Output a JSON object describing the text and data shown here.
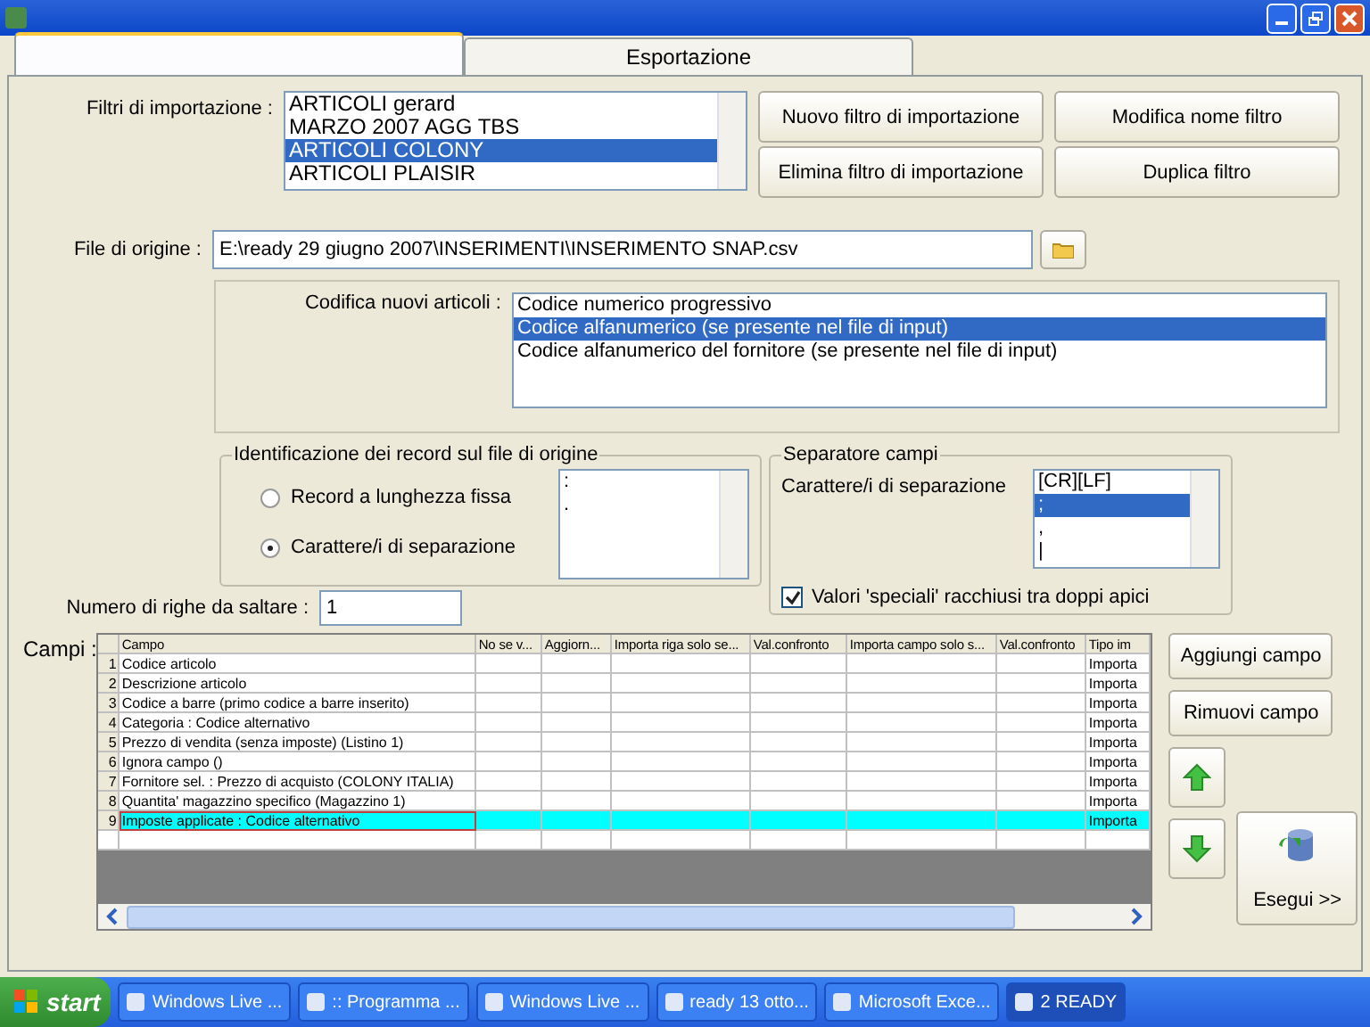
{
  "tabs": [
    {
      "selected": true
    },
    {
      "label": "Esportazione",
      "selected": false
    }
  ],
  "filters": {
    "label": "Filtri di importazione :",
    "items": [
      {
        "text": "ARTICOLI gerard",
        "selected": false
      },
      {
        "text": "MARZO 2007 AGG TBS",
        "selected": false
      },
      {
        "text": "ARTICOLI COLONY",
        "selected": true
      },
      {
        "text": "ARTICOLI PLAISIR",
        "selected": false
      }
    ],
    "buttons": [
      "Nuovo filtro di importazione",
      "Modifica nome filtro",
      "Elimina filtro di importazione",
      "Duplica filtro"
    ]
  },
  "file": {
    "label": "File di origine :",
    "value": "E:\\ready 29 giugno 2007\\INSERIMENTI\\INSERIMENTO SNAP.csv"
  },
  "coding": {
    "label": "Codifica nuovi articoli :",
    "items": [
      {
        "text": "Codice numerico progressivo",
        "selected": false
      },
      {
        "text": "Codice alfanumerico (se presente nel file di input)",
        "selected": true
      },
      {
        "text": "Codice alfanumerico del fornitore (se presente nel file di input)",
        "selected": false
      }
    ]
  },
  "identification": {
    "title": "Identificazione dei record sul file di origine",
    "options": [
      {
        "label": "Record a lunghezza fissa",
        "checked": false
      },
      {
        "label": "Carattere/i di separazione",
        "checked": true
      }
    ],
    "list": [
      {
        "text": ":",
        "selected": false
      },
      {
        "text": ".",
        "selected": false
      }
    ]
  },
  "separator": {
    "title": "Separatore campi",
    "label": "Carattere/i di separazione",
    "items": [
      {
        "text": "[CR][LF]",
        "selected": false
      },
      {
        "text": ";",
        "selected": true
      },
      {
        "text": ",",
        "selected": false
      },
      {
        "text": "|",
        "selected": false
      }
    ],
    "quotes": {
      "label": "Valori 'speciali' racchiusi tra doppi apici",
      "checked": true
    }
  },
  "skip_rows": {
    "label": "Numero di righe da saltare  :",
    "value": "1"
  },
  "fields": {
    "label": "Campi :",
    "columns": [
      "",
      "Campo",
      "No se v...",
      "Aggiorn...",
      "Importa riga solo se...",
      "Val.confronto",
      "Importa campo solo s...",
      "Val.confronto",
      "Tipo im"
    ],
    "rows": [
      {
        "num": "1",
        "campo": "Codice articolo",
        "tipo": "Importa",
        "selected": false
      },
      {
        "num": "2",
        "campo": "Descrizione articolo",
        "tipo": "Importa",
        "selected": false
      },
      {
        "num": "3",
        "campo": "Codice a barre (primo codice a barre inserito)",
        "tipo": "Importa",
        "selected": false
      },
      {
        "num": "4",
        "campo": "Categoria : Codice alternativo",
        "tipo": "Importa",
        "selected": false
      },
      {
        "num": "5",
        "campo": "Prezzo di vendita (senza imposte) (Listino 1)",
        "tipo": "Importa",
        "selected": false
      },
      {
        "num": "6",
        "campo": "Ignora campo ()",
        "tipo": "Importa",
        "selected": false
      },
      {
        "num": "7",
        "campo": "Fornitore sel. : Prezzo di acquisto (COLONY ITALIA)",
        "tipo": "Importa",
        "selected": false
      },
      {
        "num": "8",
        "campo": "Quantita' magazzino specifico (Magazzino 1)",
        "tipo": "Importa",
        "selected": false
      },
      {
        "num": "9",
        "campo": "Imposte applicate : Codice alternativo",
        "tipo": "Importa",
        "selected": true
      }
    ],
    "buttons": [
      "Aggiungi campo",
      "Rimuovi campo"
    ],
    "run": "Esegui >>"
  },
  "taskbar": {
    "start": "start",
    "items": [
      {
        "label": "Windows Live ...",
        "selected": false
      },
      {
        "label": ":: Programma ...",
        "selected": false
      },
      {
        "label": "Windows Live ...",
        "selected": false
      },
      {
        "label": "ready 13 otto...",
        "selected": false
      },
      {
        "label": "Microsoft Exce...",
        "selected": false
      },
      {
        "label": "2 READY",
        "selected": true
      }
    ]
  }
}
